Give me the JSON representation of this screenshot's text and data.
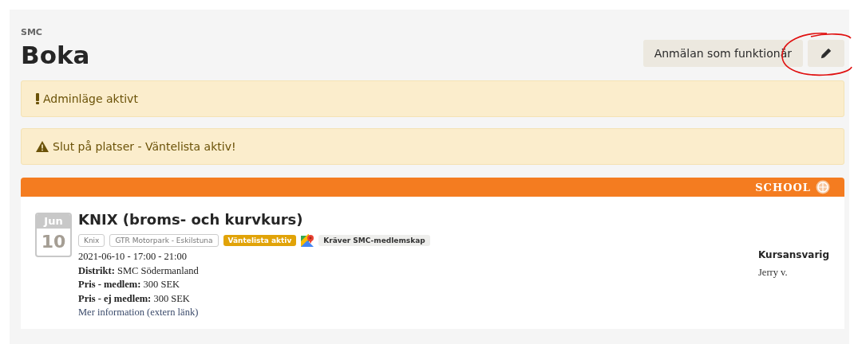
{
  "header": {
    "eyebrow": "SMC",
    "title": "Boka",
    "buttons": [
      {
        "kind": "text",
        "label": "Anmälan som funktionär"
      },
      {
        "kind": "edit"
      }
    ]
  },
  "alerts": [
    {
      "kind": "exclamation",
      "text": "Adminläge aktivt"
    },
    {
      "kind": "warning",
      "text": "Slut på platser - Väntelista aktiv!"
    }
  ],
  "event": {
    "banner": "SCHOOL",
    "month": "Jun",
    "day": "10",
    "title": "KNIX (broms- och kurvkurs)",
    "tags": [
      {
        "kind": "outline",
        "label": "Knix"
      },
      {
        "kind": "outline",
        "label": "GTR Motorpark - Eskilstuna"
      },
      {
        "kind": "warning",
        "label": "Väntelista aktiv"
      },
      {
        "kind": "map"
      },
      {
        "kind": "gray",
        "label": "Kräver SMC-medlemskap"
      }
    ],
    "lines": [
      "2021-06-10 - 17:00 - 21:00",
      "**Distrikt:** SMC Södermanland",
      "**Pris - medlem:** 300 SEK",
      "**Pris - ej medlem:** 300 SEK"
    ],
    "link": "Mer information (extern länk)",
    "responsible": {
      "heading": "Kursansvarig",
      "name": "Jerry v."
    }
  }
}
